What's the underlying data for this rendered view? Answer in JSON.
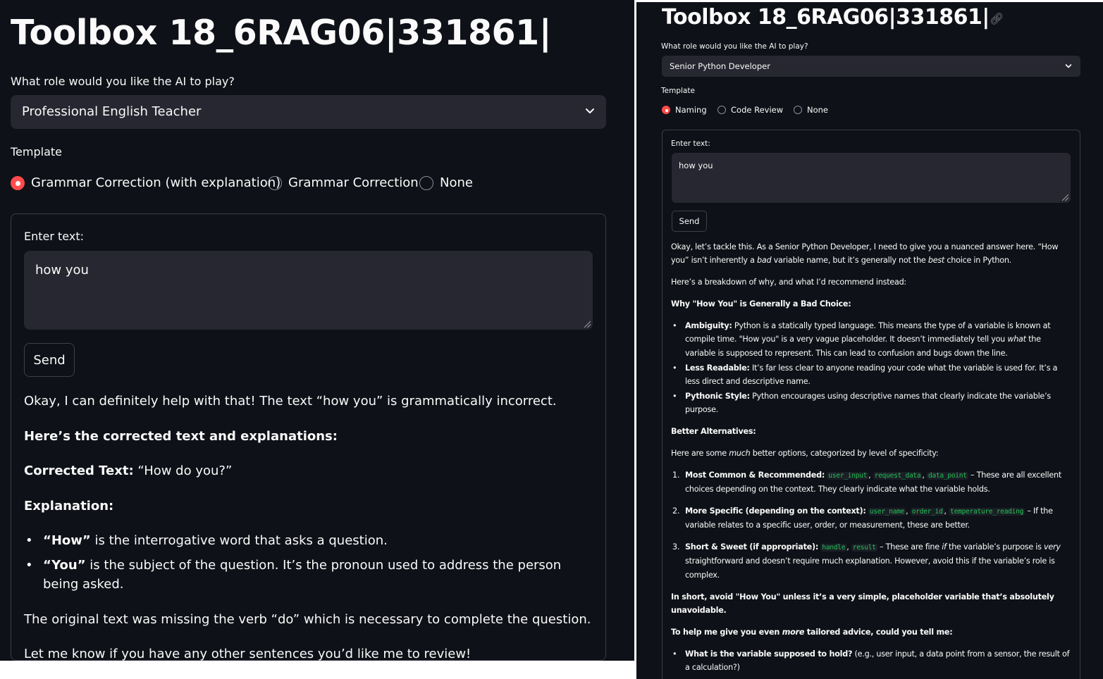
{
  "left": {
    "title": "Toolbox 18_6RAG06|331861|",
    "role_label": "What role would you like the AI to play?",
    "role_value": "Professional English Teacher",
    "template_label": "Template",
    "template_options": [
      {
        "label": "Grammar Correction (with explanation)",
        "selected": true
      },
      {
        "label": "Grammar Correction",
        "selected": false
      },
      {
        "label": "None",
        "selected": false
      }
    ],
    "enter_label": "Enter text:",
    "input_value": "how you",
    "send_label": "Send",
    "response": {
      "intro": "Okay, I can definitely help with that! The text “how you” is grammatically incorrect.",
      "heading": "Here’s the corrected text and explanations:",
      "corrected_label": "Corrected Text:",
      "corrected_value": "“How do you?”",
      "explanation_label": "Explanation:",
      "bullets": [
        {
          "bold": "“How”",
          "text": "is the interrogative word that asks a question."
        },
        {
          "bold": "“You”",
          "text": "is the subject of the question. It’s the pronoun used to address the person being asked."
        }
      ],
      "missing": "The original text was missing the verb “do” which is necessary to complete the question.",
      "closing": "Let me know if you have any other sentences you’d like me to review!"
    }
  },
  "right": {
    "title": "Toolbox 18_6RAG06|331861|",
    "role_label": "What role would you like the AI to play?",
    "role_value": "Senior Python Developer",
    "template_label": "Template",
    "template_options": [
      {
        "label": "Naming",
        "selected": true
      },
      {
        "label": "Code Review",
        "selected": false
      },
      {
        "label": "None",
        "selected": false
      }
    ],
    "enter_label": "Enter text:",
    "input_value": "how you",
    "send_label": "Send",
    "response": {
      "p1_a": "Okay, let’s tackle this. As a Senior Python Developer, I need to give you a nuanced answer here. “How you” isn’t inherently a ",
      "p1_em1": "bad",
      "p1_b": " variable name, but it’s generally not the ",
      "p1_em2": "best",
      "p1_c": " choice in Python.",
      "p2": "Here’s a breakdown of why, and what I’d recommend instead:",
      "why_heading": "Why \"How You\" is Generally a Bad Choice:",
      "why_bullets": [
        {
          "bold": "Ambiguity:",
          "a": " Python is a statically typed language. This means the type of a variable is known at compile time. \"How you\" is a very vague placeholder. It doesn’t immediately tell you ",
          "em": "what",
          "b": " the variable is supposed to represent. This can lead to confusion and bugs down the line."
        },
        {
          "bold": "Less Readable:",
          "a": " It’s far less clear to anyone reading your code what the variable is used for. It’s a less direct and descriptive name.",
          "em": "",
          "b": ""
        },
        {
          "bold": "Pythonic Style:",
          "a": " Python encourages using descriptive names that clearly indicate the variable’s purpose.",
          "em": "",
          "b": ""
        }
      ],
      "better_heading": "Better Alternatives:",
      "better_a": "Here are some ",
      "better_em": "much",
      "better_b": " better options, categorized by level of specificity:",
      "items": [
        {
          "num": "1.",
          "bold": "Most Common & Recommended:",
          "codes": [
            "user_input",
            "request_data",
            "data_point"
          ],
          "a": " – These are all excellent choices depending on the context. They clearly indicate what the variable holds.",
          "em1": "",
          "b": "",
          "em2": "",
          "c": ""
        },
        {
          "num": "2.",
          "bold": "More Specific (depending on the context):",
          "codes": [
            "user_name",
            "order_id",
            "temperature_reading"
          ],
          "a": " – If the variable relates to a specific user, order, or measurement, these are better.",
          "em1": "",
          "b": "",
          "em2": "",
          "c": ""
        },
        {
          "num": "3.",
          "bold": "Short & Sweet (if appropriate):",
          "codes": [
            "handle",
            "result"
          ],
          "a": " – These are fine ",
          "em1": "if",
          "b": " the variable’s purpose is ",
          "em2": "very",
          "c": " straightforward and doesn’t require much explanation. However, avoid this if the variable’s role is complex."
        }
      ],
      "short": "In short, avoid \"How You\" unless it’s a very simple, placeholder variable that’s absolutely unavoidable.",
      "help_a": "To help me give you even ",
      "help_em": "more",
      "help_b": " tailored advice, could you tell me:",
      "q_bullets": [
        {
          "bold": "What is the variable supposed to hold?",
          "text": " (e.g., user input, a data point from a sensor, the result of a calculation?)"
        }
      ]
    }
  }
}
